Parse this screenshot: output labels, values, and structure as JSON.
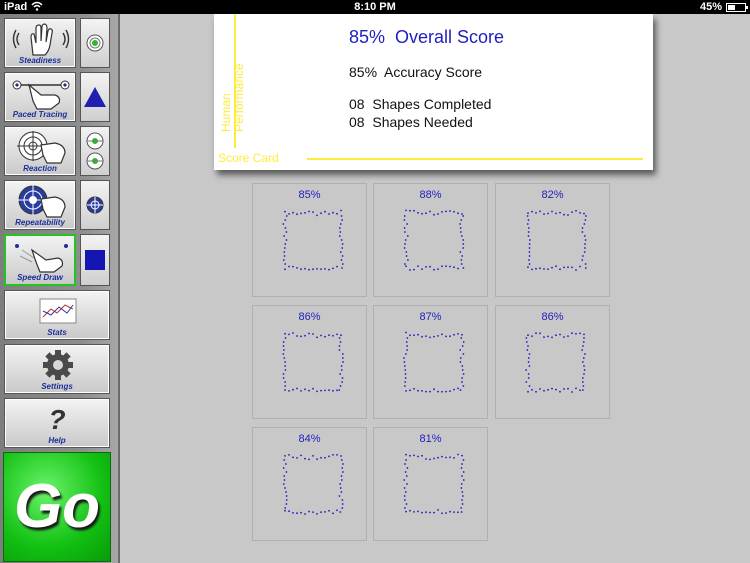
{
  "status_bar": {
    "device": "iPad",
    "time": "8:10 PM",
    "battery": "45%",
    "battery_level": 0.45
  },
  "sidebar": {
    "buttons": [
      {
        "label": "Steadiness",
        "icon": "waving-hand-icon"
      },
      {
        "label": "Paced Tracing",
        "icon": "tracing-hand-icon"
      },
      {
        "label": "Reaction",
        "icon": "reaction-target-icon"
      },
      {
        "label": "Repeatability",
        "icon": "repeatability-target-icon"
      },
      {
        "label": "Speed Draw",
        "icon": "speed-draw-hand-icon",
        "selected": true
      },
      {
        "label": "Stats",
        "icon": "stats-chart-icon"
      },
      {
        "label": "Settings",
        "icon": "gear-icon"
      },
      {
        "label": "Help",
        "icon": "question-mark-icon"
      }
    ],
    "mini_buttons": [
      {
        "icon": "green-dot-target-icon"
      },
      {
        "icon": "triangle-shape-icon"
      },
      {
        "icon": "double-green-target-icon"
      },
      {
        "icon": "blue-target-icon"
      },
      {
        "icon": "square-shape-icon"
      }
    ],
    "go_label": "Go"
  },
  "score_card": {
    "vertical_label_1": "Human",
    "vertical_label_2": "Performance",
    "footer_label": "Score Card",
    "overall": "85%  Overall Score",
    "accuracy": "85%  Accuracy Score",
    "completed": "08  Shapes Completed",
    "needed": "08  Shapes Needed"
  },
  "shapes": [
    {
      "score": "85%"
    },
    {
      "score": "88%"
    },
    {
      "score": "82%"
    },
    {
      "score": "86%"
    },
    {
      "score": "87%"
    },
    {
      "score": "86%"
    },
    {
      "score": "84%"
    },
    {
      "score": "81%"
    }
  ],
  "colors": {
    "accent_blue": "#1f1fbf",
    "scorecard_yellow": "#ffeb3b",
    "go_green": "#12c012",
    "selected_border": "#22c322"
  }
}
